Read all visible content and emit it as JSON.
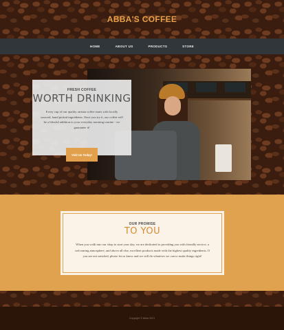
{
  "header": {
    "brand": "ABBA'S COFFEE"
  },
  "nav": {
    "items": [
      {
        "label": "HOME"
      },
      {
        "label": "ABOUT US"
      },
      {
        "label": "PRODUCTS"
      },
      {
        "label": "STORE"
      }
    ]
  },
  "hero": {
    "kicker": "FRESH COFFEE",
    "title": "WORTH DRINKING",
    "body": "Every cup of our quality artisan coffee starts with locally sourced, hand picked ingredients. Once you try it, our coffee will be a blissful addition to your everyday morning routine - we guarantee it!",
    "button_label": "Visit Us Today!"
  },
  "promise": {
    "kicker": "OUR PROMISE",
    "title": "TO YOU",
    "body": "When you walk into our shop to start your day, we are dedicated to providing you with friendly service, a welcoming atmosphere, and above all else, excellent products made with the highest quality ingredients. If you are not satisfied, please let us know and we will do whatever we can to make things right!"
  },
  "footer": {
    "copyright": "Copyright © Abba 2021"
  },
  "colors": {
    "accent": "#e0a24f",
    "brand": "#e8a14a",
    "nav_bg": "#30363a",
    "footer_bg": "#2b1509"
  }
}
